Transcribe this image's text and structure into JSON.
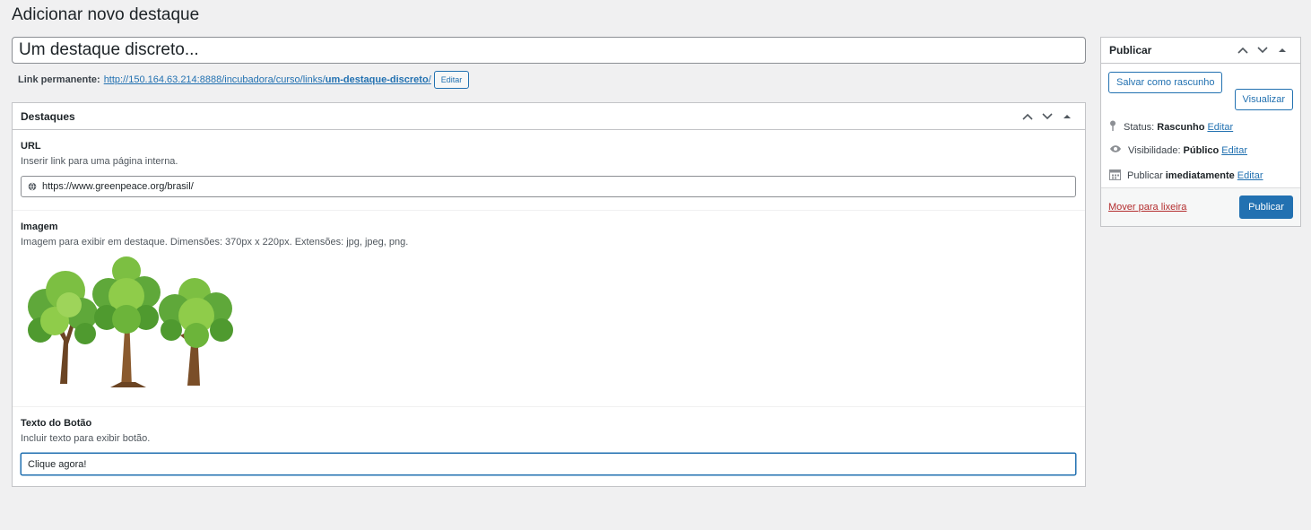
{
  "page_title": "Adicionar novo destaque",
  "post_title": "Um destaque discreto...",
  "permalink": {
    "label": "Link permanente:",
    "url_base": "http://150.164.63.214:8888/incubadora/curso/links/",
    "slug": "um-destaque-discreto",
    "url_tail": "/",
    "edit_label": "Editar"
  },
  "metabox": {
    "title": "Destaques",
    "fields": {
      "url": {
        "label": "URL",
        "description": "Inserir link para uma página interna.",
        "value": "https://www.greenpeace.org/brasil/"
      },
      "image": {
        "label": "Imagem",
        "description": "Imagem para exibir em destaque. Dimensões: 370px x 220px. Extensões: jpg, jpeg, png."
      },
      "button_text": {
        "label": "Texto do Botão",
        "description": "Incluir texto para exibir botão.",
        "value": "Clique agora!"
      }
    }
  },
  "publish": {
    "title": "Publicar",
    "save_draft_label": "Salvar como rascunho",
    "preview_label": "Visualizar",
    "status_label": "Status:",
    "status_value": "Rascunho",
    "visibility_label": "Visibilidade:",
    "visibility_value": "Público",
    "schedule_label": "Publicar",
    "schedule_value": "imediatamente",
    "edit_label": "Editar",
    "trash_label": "Mover para lixeira",
    "publish_label": "Publicar"
  },
  "colors": {
    "accent": "#2271b1",
    "danger": "#b32d2e",
    "background": "#f0f0f1"
  }
}
